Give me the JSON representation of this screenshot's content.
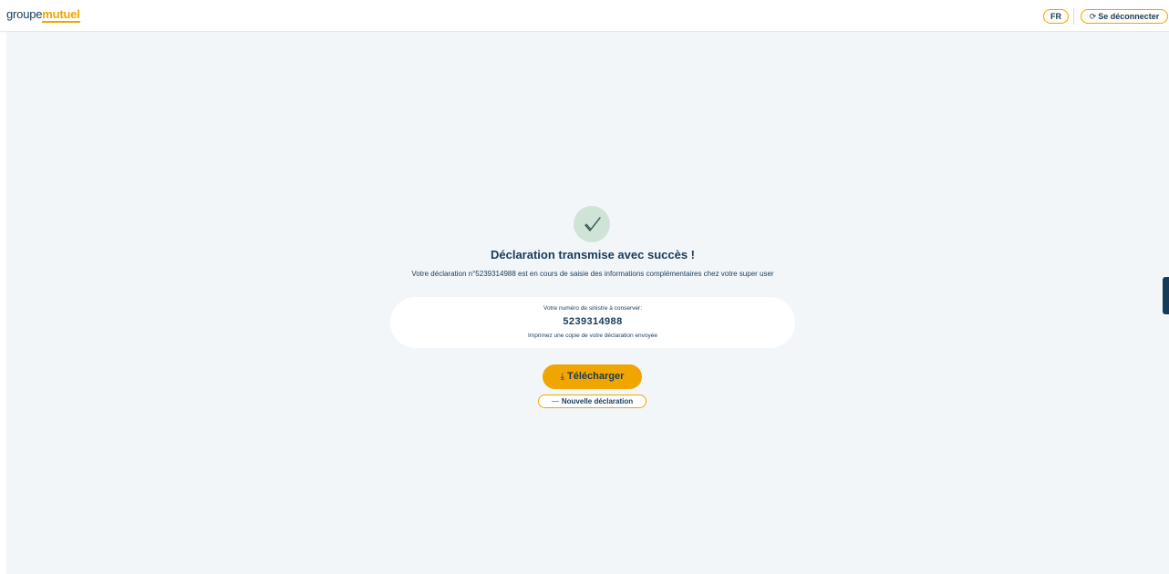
{
  "header": {
    "logo_part1": "groupe",
    "logo_part2": "mutuel",
    "lang_label": "FR",
    "logout_label": "Se déconnecter"
  },
  "confirmation": {
    "title": "Déclaration transmise avec succès !",
    "message": "Votre déclaration n°5239314988 est en cours de saisie des informations complémentaires chez votre super user",
    "claim_label": "Votre numéro de sinistre à conserver:",
    "claim_number": "5239314988",
    "print_hint": "Imprimez une copie de votre déclaration envoyée",
    "download_label": "Télécharger",
    "new_label": "Nouvelle déclaration"
  },
  "icons": {
    "success": "check-icon",
    "download": "download-icon",
    "logout": "logout-icon",
    "new": "minus-icon"
  },
  "colors": {
    "brand_navy": "#163b5a",
    "brand_yellow": "#f0a500",
    "success_bg": "#cfe3d6",
    "page_bg": "#f3f6f9"
  }
}
